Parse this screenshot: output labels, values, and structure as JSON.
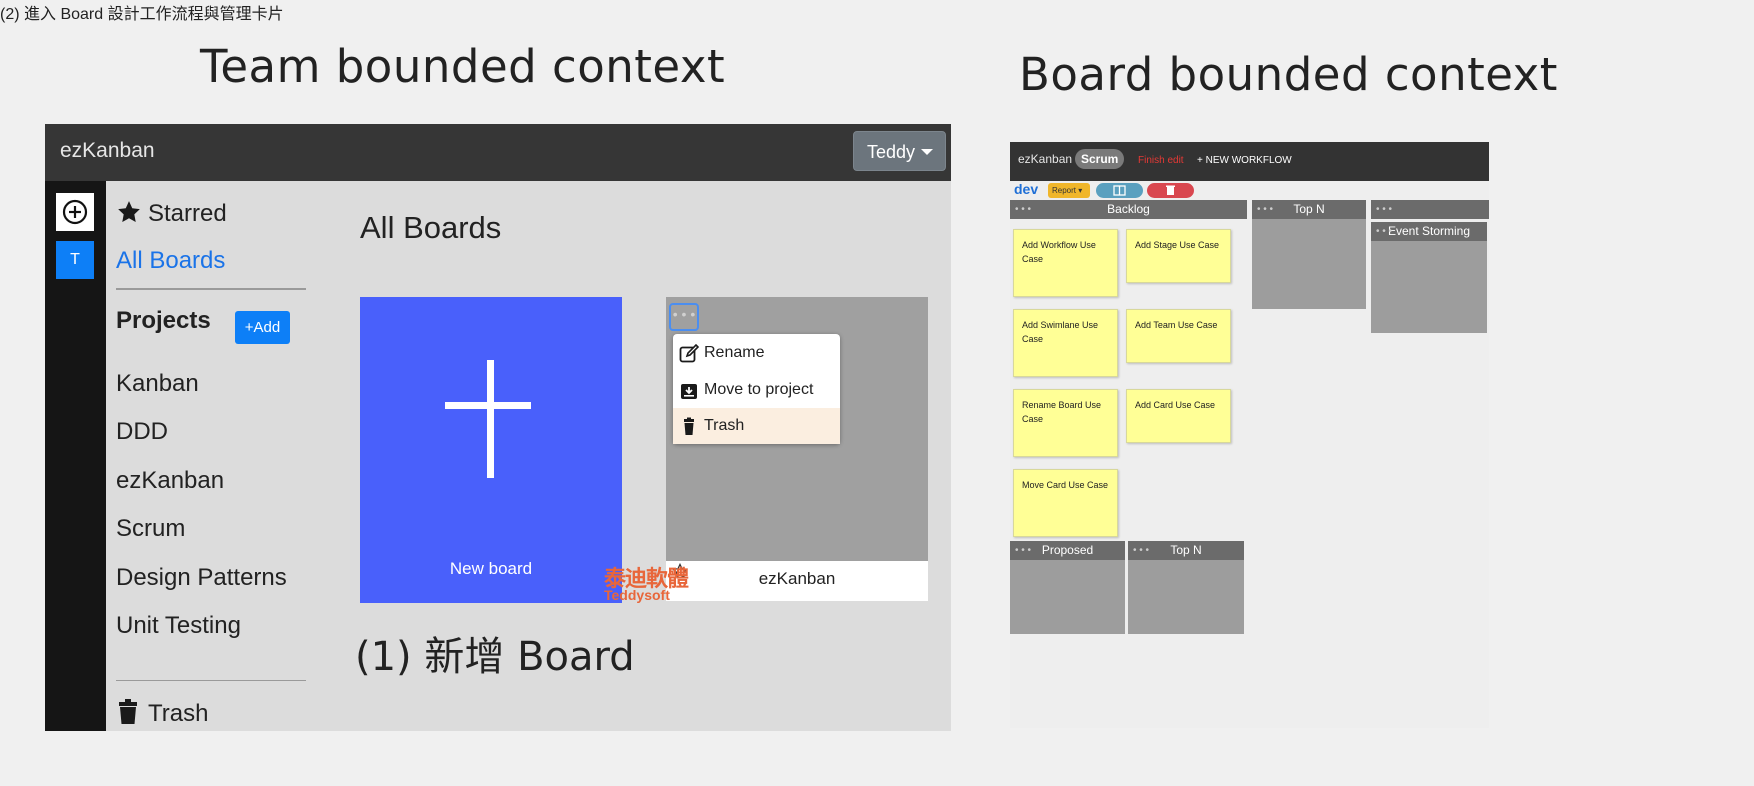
{
  "headings": {
    "team": "Team bounded context",
    "board": "Board bounded context"
  },
  "team_app": {
    "brand": "ezKanban",
    "user_menu": "Teddy",
    "team_initial": "T",
    "sidebar": {
      "starred": "Starred",
      "all_boards": "All Boards",
      "projects_label": "Projects",
      "add_project": "+Add",
      "projects": [
        "Kanban",
        "DDD",
        "ezKanban",
        "Scrum",
        "Design Patterns",
        "Unit Testing"
      ],
      "trash": "Trash"
    },
    "main_title": "All Boards",
    "new_board_label": "New board",
    "board_card_name": "ezKanban",
    "context_menu": {
      "rename": "Rename",
      "move": "Move to project",
      "trash": "Trash"
    },
    "watermark_cn": "泰迪軟體",
    "watermark_en": "Teddysoft",
    "caption": "(1) 新增 Board"
  },
  "board_app": {
    "brand": "ezKanban",
    "board_pill": "Scrum",
    "finish_edit": "Finish edit",
    "new_workflow": "+ NEW WORKFLOW",
    "workflow_name": "dev",
    "report_btn": "Report ▾",
    "lanes": {
      "backlog": "Backlog",
      "top_n": "Top N",
      "event_storming": "Event Storming",
      "proposed": "Proposed",
      "top_n_2": "Top N"
    },
    "cards": [
      "Add Workflow Use Case",
      "Add Stage Use Case",
      "Add Swimlane Use Case",
      "Add Team Use Case",
      "Rename Board Use Case",
      "Add Card Use Case",
      "Move Card Use Case"
    ],
    "caption": "(2) 進入 Board 設計工作流程與管理卡片"
  },
  "colors": {
    "accent_blue": "#0d7ff7",
    "new_board_blue": "#4960fb",
    "sticky_yellow": "#ffff96",
    "topbar": "#363636"
  }
}
